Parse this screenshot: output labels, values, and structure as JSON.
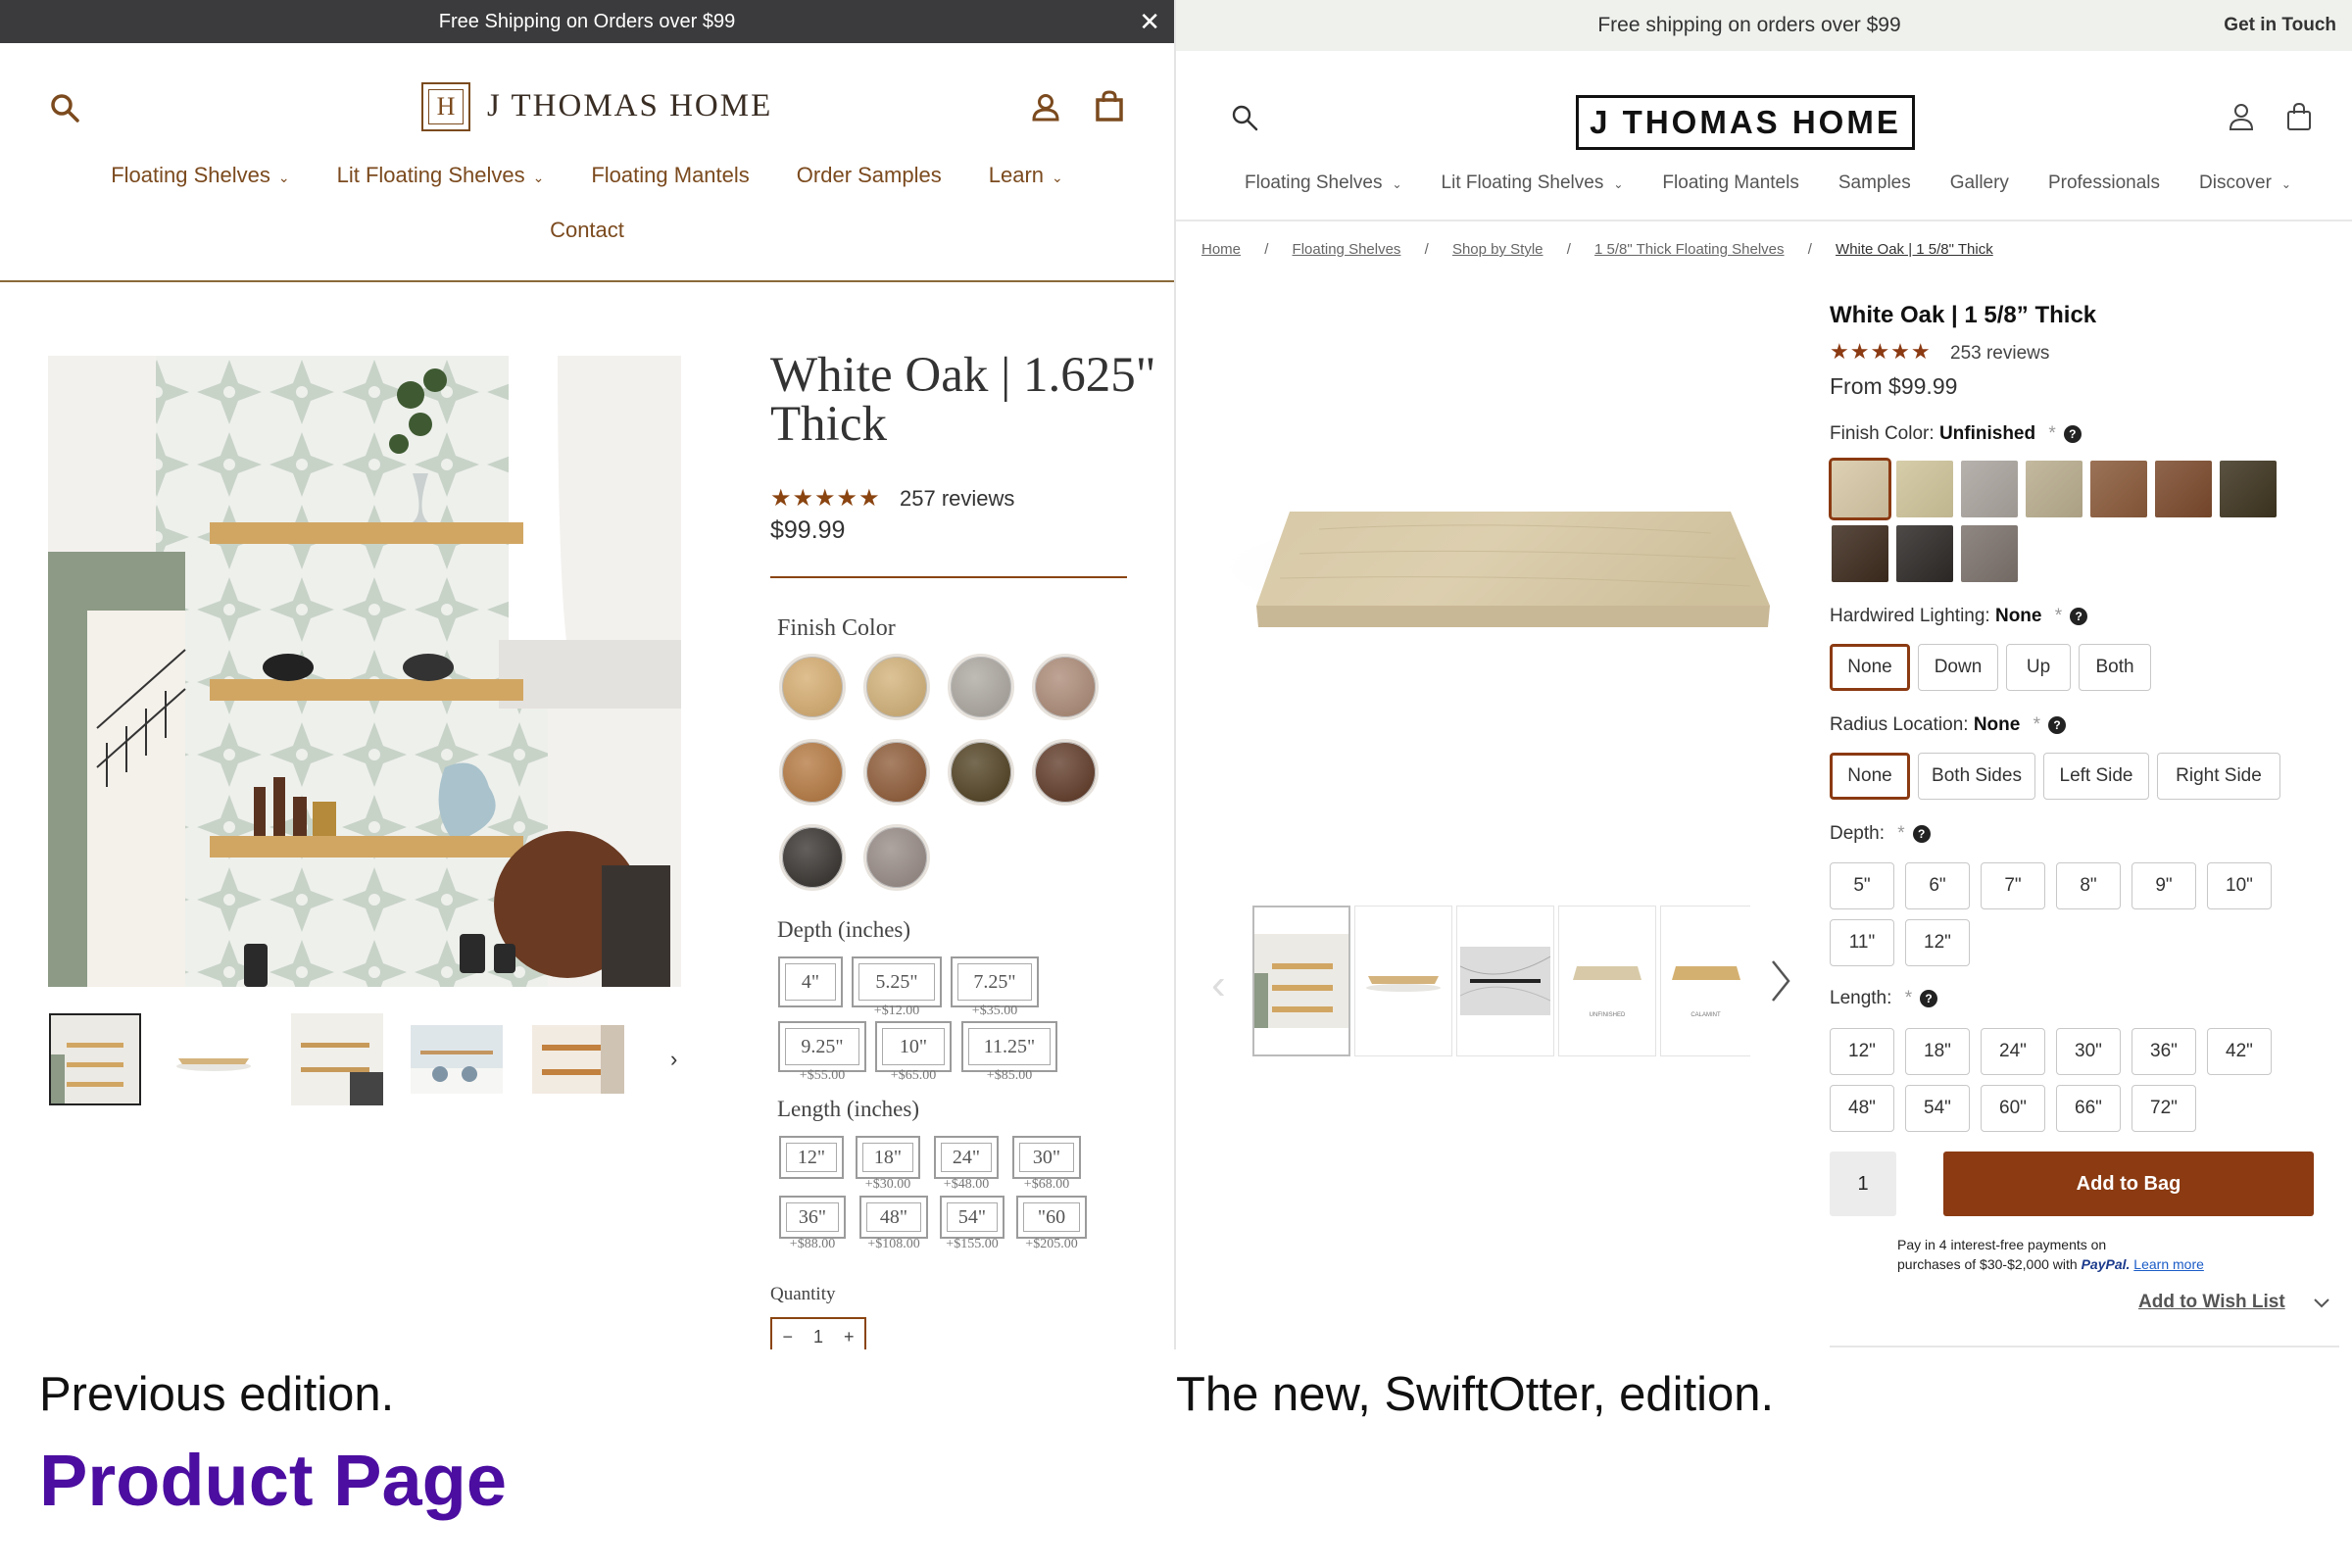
{
  "left": {
    "banner": "Free Shipping on Orders over $99",
    "logo_text": "J THOMAS HOME",
    "logo_mark": "H",
    "nav": [
      {
        "label": "Floating Shelves",
        "chevron": true
      },
      {
        "label": "Lit Floating Shelves",
        "chevron": true
      },
      {
        "label": "Floating Mantels",
        "chevron": false
      },
      {
        "label": "Order Samples",
        "chevron": false
      },
      {
        "label": "Learn",
        "chevron": true
      }
    ],
    "nav_row2": "Contact",
    "product_title": "White Oak | 1.625\" Thick",
    "reviews": "257 reviews",
    "price": "$99.99",
    "finish_label": "Finish Color",
    "finish_colors": [
      "#d4a96a",
      "#d0ae73",
      "#a9a49c",
      "#a98672",
      "#b2743a",
      "#8a5530",
      "#4a3a1a",
      "#5a3320",
      "#2f2a26",
      "#938680"
    ],
    "depth_label": "Depth (inches)",
    "depth_options": [
      {
        "label": "4\"",
        "sub": ""
      },
      {
        "label": "5.25\"",
        "sub": "+$12.00"
      },
      {
        "label": "7.25\"",
        "sub": "+$35.00"
      },
      {
        "label": "9.25\"",
        "sub": "+$55.00"
      },
      {
        "label": "10\"",
        "sub": "+$65.00"
      },
      {
        "label": "11.25\"",
        "sub": "+$85.00"
      }
    ],
    "length_label": "Length (inches)",
    "length_options": [
      {
        "label": "12\"",
        "sub": ""
      },
      {
        "label": "18\"",
        "sub": "+$30.00"
      },
      {
        "label": "24\"",
        "sub": "+$48.00"
      },
      {
        "label": "30\"",
        "sub": "+$68.00"
      },
      {
        "label": "36\"",
        "sub": "+$88.00"
      },
      {
        "label": "48\"",
        "sub": "+$108.00"
      },
      {
        "label": "54\"",
        "sub": "+$155.00"
      },
      {
        "label": "\"60",
        "sub": "+$205.00"
      }
    ],
    "quantity_label": "Quantity",
    "quantity_value": "1",
    "quantity_minus": "−",
    "quantity_plus": "+",
    "thumb_next": "›"
  },
  "right": {
    "banner": "Free shipping on orders over $99",
    "banner_right": "Get in Touch",
    "logo_text": "J THOMAS HOME",
    "nav": [
      {
        "label": "Floating Shelves",
        "chevron": true
      },
      {
        "label": "Lit Floating Shelves",
        "chevron": true
      },
      {
        "label": "Floating Mantels",
        "chevron": false
      },
      {
        "label": "Samples",
        "chevron": false
      },
      {
        "label": "Gallery",
        "chevron": false
      },
      {
        "label": "Professionals",
        "chevron": false
      },
      {
        "label": "Discover",
        "chevron": true
      }
    ],
    "breadcrumbs": [
      "Home",
      "Floating Shelves",
      "Shop by Style",
      "1 5/8\" Thick Floating Shelves",
      "White Oak | 1 5/8\" Thick"
    ],
    "breadcrumb_sep": "/",
    "product_title": "White Oak | 1 5/8” Thick",
    "reviews": "253 reviews",
    "price": "From $99.99",
    "finish_label": "Finish Color:",
    "finish_value": "Unfinished",
    "finish_colors": [
      "#d7c8a6",
      "#cfc49a",
      "#aaa49e",
      "#b9ad8e",
      "#8a5a3a",
      "#7b4a2c",
      "#3e3420",
      "#3d2b1e",
      "#2e2a28",
      "#7c726c"
    ],
    "lighting_label": "Hardwired Lighting:",
    "lighting_value": "None",
    "lighting_options": [
      "None",
      "Down",
      "Up",
      "Both"
    ],
    "radius_label": "Radius Location:",
    "radius_value": "None",
    "radius_options": [
      "None",
      "Both Sides",
      "Left Side",
      "Right Side"
    ],
    "depth_label": "Depth:",
    "depth_options": [
      "5\"",
      "6\"",
      "7\"",
      "8\"",
      "9\"",
      "10\"",
      "11\"",
      "12\""
    ],
    "length_label": "Length:",
    "length_options": [
      "12\"",
      "18\"",
      "24\"",
      "30\"",
      "36\"",
      "42\"",
      "48\"",
      "54\"",
      "60\"",
      "66\"",
      "72\""
    ],
    "required_mark": "*",
    "help_mark": "?",
    "quantity_value": "1",
    "add_to_bag": "Add to Bag",
    "paypal_line1": "Pay in 4 interest-free payments on",
    "paypal_line2": "purchases of $30-$2,000 with",
    "paypal_brand": "PayPal.",
    "paypal_link": "Learn more",
    "wishlist": "Add to Wish List",
    "thumb_labels": [
      "",
      "",
      "",
      "UNFINISHED",
      "CALAMINT"
    ],
    "accent": "#8b3a12"
  },
  "captions": {
    "left": "Previous edition.",
    "right": "The new, SwiftOtter, edition.",
    "title": "Product Page"
  }
}
